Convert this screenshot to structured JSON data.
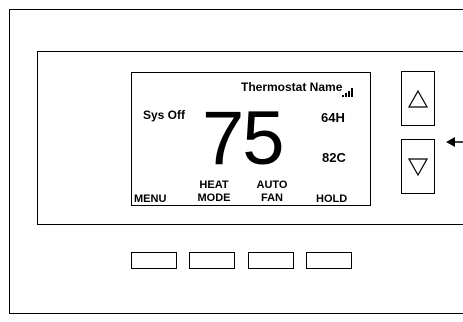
{
  "display": {
    "thermostat_name": "Thermostat Name",
    "system_status": "Sys Off",
    "setpoint": "75",
    "heat_setpoint": "64H",
    "cool_setpoint": "82C",
    "signal_icon": "signal-strength-icon",
    "soft_labels": {
      "menu": "MENU",
      "mode_line1": "HEAT",
      "mode_line2": "MODE",
      "fan_line1": "AUTO",
      "fan_line2": "FAN",
      "hold": "HOLD"
    }
  },
  "controls": {
    "up_icon": "triangle-up-icon",
    "down_icon": "triangle-down-icon",
    "pointer_icon": "pointer-arrow-icon"
  }
}
